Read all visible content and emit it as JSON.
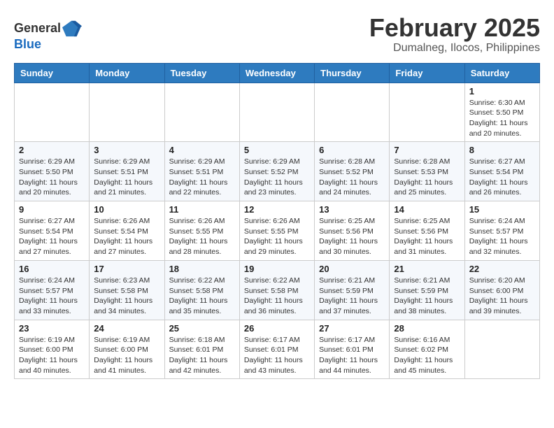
{
  "logo": {
    "general": "General",
    "blue": "Blue"
  },
  "title": {
    "month": "February 2025",
    "location": "Dumalneg, Ilocos, Philippines"
  },
  "weekdays": [
    "Sunday",
    "Monday",
    "Tuesday",
    "Wednesday",
    "Thursday",
    "Friday",
    "Saturday"
  ],
  "weeks": [
    [
      {
        "day": "",
        "info": ""
      },
      {
        "day": "",
        "info": ""
      },
      {
        "day": "",
        "info": ""
      },
      {
        "day": "",
        "info": ""
      },
      {
        "day": "",
        "info": ""
      },
      {
        "day": "",
        "info": ""
      },
      {
        "day": "1",
        "info": "Sunrise: 6:30 AM\nSunset: 5:50 PM\nDaylight: 11 hours\nand 20 minutes."
      }
    ],
    [
      {
        "day": "2",
        "info": "Sunrise: 6:29 AM\nSunset: 5:50 PM\nDaylight: 11 hours\nand 20 minutes."
      },
      {
        "day": "3",
        "info": "Sunrise: 6:29 AM\nSunset: 5:51 PM\nDaylight: 11 hours\nand 21 minutes."
      },
      {
        "day": "4",
        "info": "Sunrise: 6:29 AM\nSunset: 5:51 PM\nDaylight: 11 hours\nand 22 minutes."
      },
      {
        "day": "5",
        "info": "Sunrise: 6:29 AM\nSunset: 5:52 PM\nDaylight: 11 hours\nand 23 minutes."
      },
      {
        "day": "6",
        "info": "Sunrise: 6:28 AM\nSunset: 5:52 PM\nDaylight: 11 hours\nand 24 minutes."
      },
      {
        "day": "7",
        "info": "Sunrise: 6:28 AM\nSunset: 5:53 PM\nDaylight: 11 hours\nand 25 minutes."
      },
      {
        "day": "8",
        "info": "Sunrise: 6:27 AM\nSunset: 5:54 PM\nDaylight: 11 hours\nand 26 minutes."
      }
    ],
    [
      {
        "day": "9",
        "info": "Sunrise: 6:27 AM\nSunset: 5:54 PM\nDaylight: 11 hours\nand 27 minutes."
      },
      {
        "day": "10",
        "info": "Sunrise: 6:26 AM\nSunset: 5:54 PM\nDaylight: 11 hours\nand 27 minutes."
      },
      {
        "day": "11",
        "info": "Sunrise: 6:26 AM\nSunset: 5:55 PM\nDaylight: 11 hours\nand 28 minutes."
      },
      {
        "day": "12",
        "info": "Sunrise: 6:26 AM\nSunset: 5:55 PM\nDaylight: 11 hours\nand 29 minutes."
      },
      {
        "day": "13",
        "info": "Sunrise: 6:25 AM\nSunset: 5:56 PM\nDaylight: 11 hours\nand 30 minutes."
      },
      {
        "day": "14",
        "info": "Sunrise: 6:25 AM\nSunset: 5:56 PM\nDaylight: 11 hours\nand 31 minutes."
      },
      {
        "day": "15",
        "info": "Sunrise: 6:24 AM\nSunset: 5:57 PM\nDaylight: 11 hours\nand 32 minutes."
      }
    ],
    [
      {
        "day": "16",
        "info": "Sunrise: 6:24 AM\nSunset: 5:57 PM\nDaylight: 11 hours\nand 33 minutes."
      },
      {
        "day": "17",
        "info": "Sunrise: 6:23 AM\nSunset: 5:58 PM\nDaylight: 11 hours\nand 34 minutes."
      },
      {
        "day": "18",
        "info": "Sunrise: 6:22 AM\nSunset: 5:58 PM\nDaylight: 11 hours\nand 35 minutes."
      },
      {
        "day": "19",
        "info": "Sunrise: 6:22 AM\nSunset: 5:58 PM\nDaylight: 11 hours\nand 36 minutes."
      },
      {
        "day": "20",
        "info": "Sunrise: 6:21 AM\nSunset: 5:59 PM\nDaylight: 11 hours\nand 37 minutes."
      },
      {
        "day": "21",
        "info": "Sunrise: 6:21 AM\nSunset: 5:59 PM\nDaylight: 11 hours\nand 38 minutes."
      },
      {
        "day": "22",
        "info": "Sunrise: 6:20 AM\nSunset: 6:00 PM\nDaylight: 11 hours\nand 39 minutes."
      }
    ],
    [
      {
        "day": "23",
        "info": "Sunrise: 6:19 AM\nSunset: 6:00 PM\nDaylight: 11 hours\nand 40 minutes."
      },
      {
        "day": "24",
        "info": "Sunrise: 6:19 AM\nSunset: 6:00 PM\nDaylight: 11 hours\nand 41 minutes."
      },
      {
        "day": "25",
        "info": "Sunrise: 6:18 AM\nSunset: 6:01 PM\nDaylight: 11 hours\nand 42 minutes."
      },
      {
        "day": "26",
        "info": "Sunrise: 6:17 AM\nSunset: 6:01 PM\nDaylight: 11 hours\nand 43 minutes."
      },
      {
        "day": "27",
        "info": "Sunrise: 6:17 AM\nSunset: 6:01 PM\nDaylight: 11 hours\nand 44 minutes."
      },
      {
        "day": "28",
        "info": "Sunrise: 6:16 AM\nSunset: 6:02 PM\nDaylight: 11 hours\nand 45 minutes."
      },
      {
        "day": "",
        "info": ""
      }
    ]
  ]
}
